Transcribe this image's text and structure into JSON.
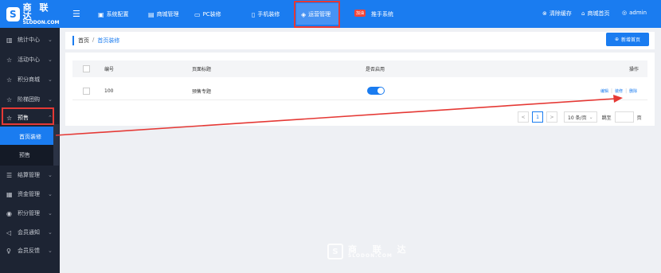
{
  "brand": {
    "mark": "S",
    "name": "商 联 达",
    "domain": "SLODON.COM"
  },
  "topnav": {
    "items": [
      {
        "icon": "▣",
        "label": "系统配置"
      },
      {
        "icon": "▤",
        "label": "商城管理"
      },
      {
        "icon": "▭",
        "label": "PC装修"
      },
      {
        "icon": "▯",
        "label": "手机装修"
      },
      {
        "icon": "◈",
        "label": "运营管理"
      },
      {
        "icon": "▲",
        "label": "推手系统"
      }
    ],
    "new_badge": "加油",
    "right": [
      {
        "icon": "⊗",
        "label": "清除缓存"
      },
      {
        "icon": "⌂",
        "label": "商城首页"
      },
      {
        "icon": "◎",
        "label": "admin"
      }
    ]
  },
  "sidebar": {
    "items": [
      {
        "icon": "▥",
        "label": "统计中心"
      },
      {
        "icon": "☆",
        "label": "活动中心"
      },
      {
        "icon": "☆",
        "label": "积分商城"
      },
      {
        "icon": "☆",
        "label": "阶梯团购"
      },
      {
        "icon": "☆",
        "label": "预售"
      },
      {
        "icon": "",
        "label": "首页装修"
      },
      {
        "icon": "",
        "label": "预售"
      },
      {
        "icon": "☰",
        "label": "结算管理"
      },
      {
        "icon": "▦",
        "label": "资金管理"
      },
      {
        "icon": "◉",
        "label": "积分管理"
      },
      {
        "icon": "◁",
        "label": "会员通知"
      },
      {
        "icon": "♀",
        "label": "会员反馈"
      }
    ]
  },
  "breadcrumb": {
    "home": "首页",
    "sep": "/",
    "current": "首页装修"
  },
  "add_button": {
    "icon": "⊕",
    "label": "新增首页"
  },
  "table": {
    "headers": [
      "编号",
      "页面标题",
      "是否启用",
      "操作"
    ],
    "rows": [
      {
        "id": "100",
        "title": "预售专题",
        "enabled": true,
        "actions": [
          "编辑",
          "装修",
          "删除"
        ]
      }
    ]
  },
  "pagination": {
    "prev": "<",
    "page": "1",
    "next": ">",
    "page_size": "10 条/页",
    "jump_label": "跳至",
    "page_suffix": "页"
  },
  "watermark": {
    "mark": "S",
    "name": "商 联 达",
    "domain": "SLODON.COM"
  },
  "colors": {
    "brand": "#1a7cf0",
    "sidebar": "#1d2433",
    "highlight": "#e53935"
  }
}
